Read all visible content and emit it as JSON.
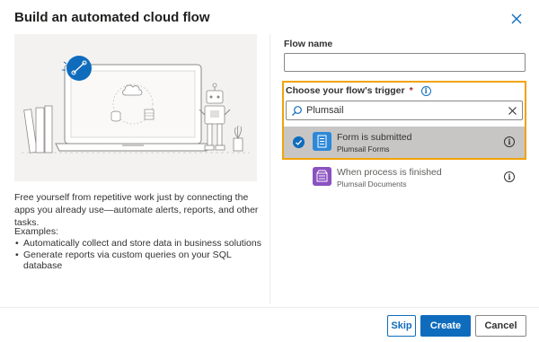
{
  "dialog": {
    "title": "Build an automated cloud flow",
    "description": "Free yourself from repetitive work just by connecting the apps you already use—automate alerts, reports, and other tasks.",
    "examples_title": "Examples:",
    "examples": [
      "Automatically collect and store data in business solutions",
      "Generate reports via custom queries on your SQL database"
    ]
  },
  "form": {
    "flow_name_label": "Flow name",
    "flow_name_value": "",
    "trigger_label": "Choose your flow's trigger",
    "required_mark": "*",
    "search_value": "Plumsail"
  },
  "triggers": [
    {
      "title": "Form is submitted",
      "subtitle": "Plumsail Forms",
      "selected": true,
      "icon": "plumsail-forms-icon",
      "color": "#2d88d8"
    },
    {
      "title": "When process is finished",
      "subtitle": "Plumsail Documents",
      "selected": false,
      "icon": "plumsail-documents-icon",
      "color": "#8a52c1"
    }
  ],
  "footer": {
    "skip_label": "Skip",
    "create_label": "Create",
    "cancel_label": "Cancel"
  },
  "colors": {
    "accent": "#0f6cbd",
    "highlight_border": "#f0a30a",
    "selected_row": "#c8c6c4"
  }
}
